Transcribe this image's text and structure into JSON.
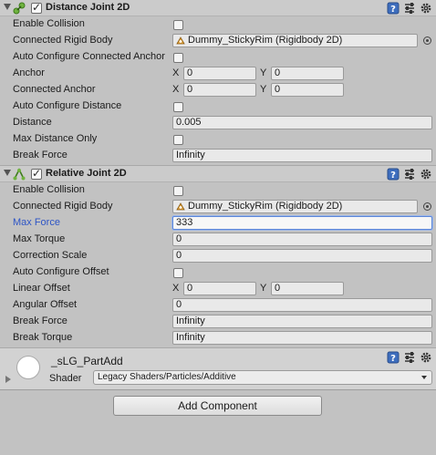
{
  "distance_joint": {
    "title": "Distance Joint 2D",
    "rows": {
      "enable_collision": "Enable Collision",
      "connected_rigid_body": "Connected Rigid Body",
      "connected_rigid_body_value": "Dummy_StickyRim (Rigidbody 2D)",
      "auto_configure_connected_anchor": "Auto Configure Connected Anchor",
      "anchor": "Anchor",
      "anchor_x": "0",
      "anchor_y": "0",
      "connected_anchor": "Connected Anchor",
      "connected_anchor_x": "0",
      "connected_anchor_y": "0",
      "auto_configure_distance": "Auto Configure Distance",
      "distance": "Distance",
      "distance_value": "0.005",
      "max_distance_only": "Max Distance Only",
      "break_force": "Break Force",
      "break_force_value": "Infinity"
    }
  },
  "relative_joint": {
    "title": "Relative Joint 2D",
    "rows": {
      "enable_collision": "Enable Collision",
      "connected_rigid_body": "Connected Rigid Body",
      "connected_rigid_body_value": "Dummy_StickyRim (Rigidbody 2D)",
      "max_force": "Max Force",
      "max_force_value": "333",
      "max_torque": "Max Torque",
      "max_torque_value": "0",
      "correction_scale": "Correction Scale",
      "correction_scale_value": "0",
      "auto_configure_offset": "Auto Configure Offset",
      "linear_offset": "Linear Offset",
      "linear_offset_x": "0",
      "linear_offset_y": "0",
      "angular_offset": "Angular Offset",
      "angular_offset_value": "0",
      "break_force": "Break Force",
      "break_force_value": "Infinity",
      "break_torque": "Break Torque",
      "break_torque_value": "Infinity"
    }
  },
  "axis_labels": {
    "x": "X",
    "y": "Y"
  },
  "material": {
    "name": "_sLG_PartAdd",
    "shader_label": "Shader",
    "shader_value": "Legacy Shaders/Particles/Additive"
  },
  "add_component_label": "Add Component",
  "colors": {
    "focus": "#5b86d8",
    "highlight_label": "#2e55c6",
    "background": "#c2c2c2"
  },
  "icons": [
    "fold-arrow-icon",
    "distance-joint-icon",
    "relative-joint-icon",
    "help-book-icon",
    "preset-sliders-icon",
    "gear-icon",
    "rigidbody-icon",
    "object-picker-icon"
  ]
}
